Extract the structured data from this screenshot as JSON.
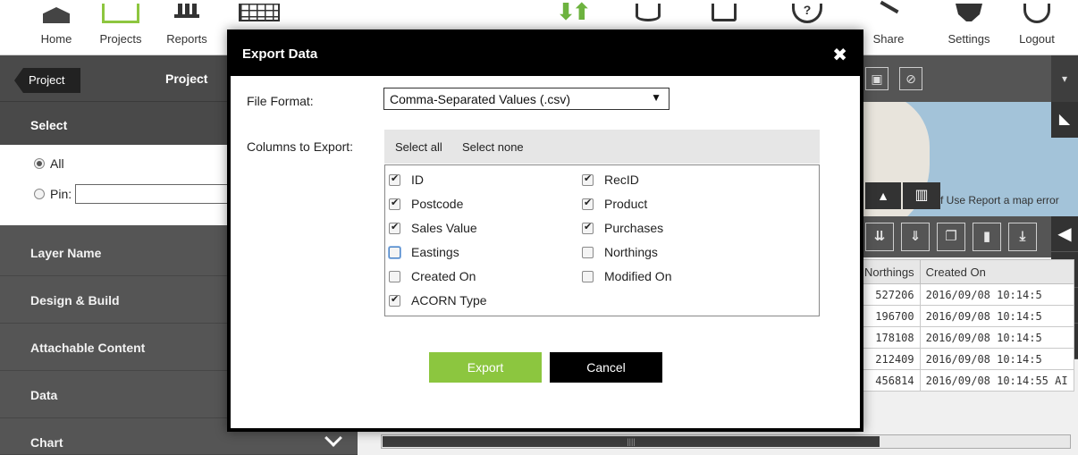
{
  "toolbar": {
    "items": [
      {
        "label": "Home"
      },
      {
        "label": "Projects"
      },
      {
        "label": "Reports"
      },
      {
        "label": "Share"
      },
      {
        "label": "Settings"
      },
      {
        "label": "Logout"
      }
    ]
  },
  "sidebar": {
    "project_button": "Project",
    "project_title": "Project",
    "select_heading": "Select",
    "radio_all": "All",
    "radio_pin": "Pin:",
    "sections": [
      "Layer Name",
      "Design & Build",
      "Attachable Content",
      "Data",
      "Chart"
    ]
  },
  "map": {
    "footer": "f Use   Report a map error"
  },
  "grid": {
    "headers": [
      "Northings",
      "Created On"
    ],
    "rows": [
      [
        "527206",
        "2016/09/08 10:14:5"
      ],
      [
        "196700",
        "2016/09/08 10:14:5"
      ],
      [
        "178108",
        "2016/09/08 10:14:5"
      ],
      [
        "212409",
        "2016/09/08 10:14:5"
      ],
      [
        "456814",
        "2016/09/08 10:14:55 AI"
      ]
    ]
  },
  "modal": {
    "title": "Export Data",
    "close_glyph": "✖",
    "file_format_label": "File Format:",
    "file_format_value": "Comma-Separated Values (.csv)",
    "columns_label": "Columns to Export:",
    "select_all": "Select all",
    "select_none": "Select none",
    "columns": [
      {
        "label": "ID",
        "checked": true
      },
      {
        "label": "RecID",
        "checked": true
      },
      {
        "label": "Postcode",
        "checked": true
      },
      {
        "label": "Product",
        "checked": true
      },
      {
        "label": "Sales Value",
        "checked": true
      },
      {
        "label": "Purchases",
        "checked": true
      },
      {
        "label": "Eastings",
        "checked": false
      },
      {
        "label": "Northings",
        "checked": false
      },
      {
        "label": "Created On",
        "checked": false
      },
      {
        "label": "Modified On",
        "checked": false
      },
      {
        "label": "ACORN Type",
        "checked": true
      }
    ],
    "export_label": "Export",
    "cancel_label": "Cancel"
  },
  "colors": {
    "accent_green": "#8cc63f",
    "modal_header": "#000000",
    "sidebar_bg": "#555555"
  }
}
